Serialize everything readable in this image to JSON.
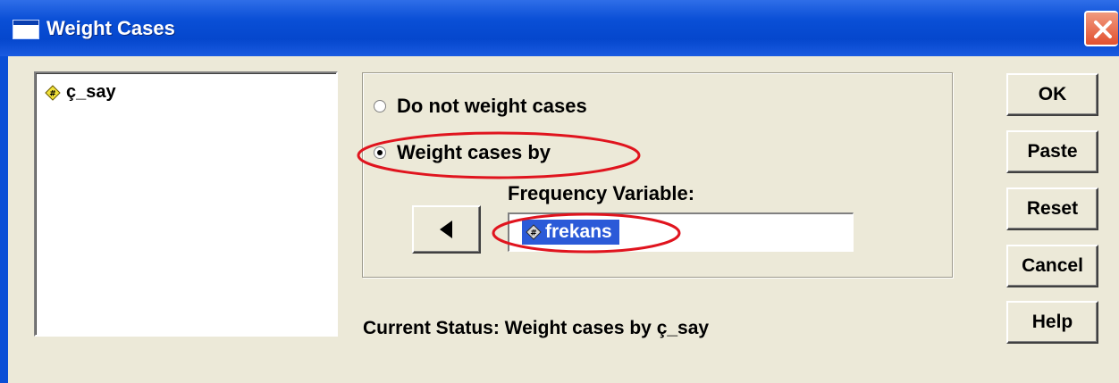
{
  "window": {
    "title": "Weight Cases"
  },
  "variable_list": {
    "items": [
      {
        "name": "ç_say",
        "icon": "scale-variable-icon"
      }
    ]
  },
  "weight_options": {
    "do_not_weight_label": "Do not weight cases",
    "weight_by_label": "Weight cases by",
    "selected": "weight_by"
  },
  "frequency": {
    "label": "Frequency Variable:",
    "value": "frekans",
    "value_icon": "scale-variable-icon"
  },
  "status": {
    "text": "Current Status: Weight cases by ç_say"
  },
  "buttons": {
    "ok": "OK",
    "paste": "Paste",
    "reset": "Reset",
    "cancel": "Cancel",
    "help": "Help"
  },
  "colors": {
    "title_bar": "#0a4fd6",
    "dialog_bg": "#ece9d8",
    "highlight": "#2b5ad8",
    "annotation": "#e0141e"
  }
}
